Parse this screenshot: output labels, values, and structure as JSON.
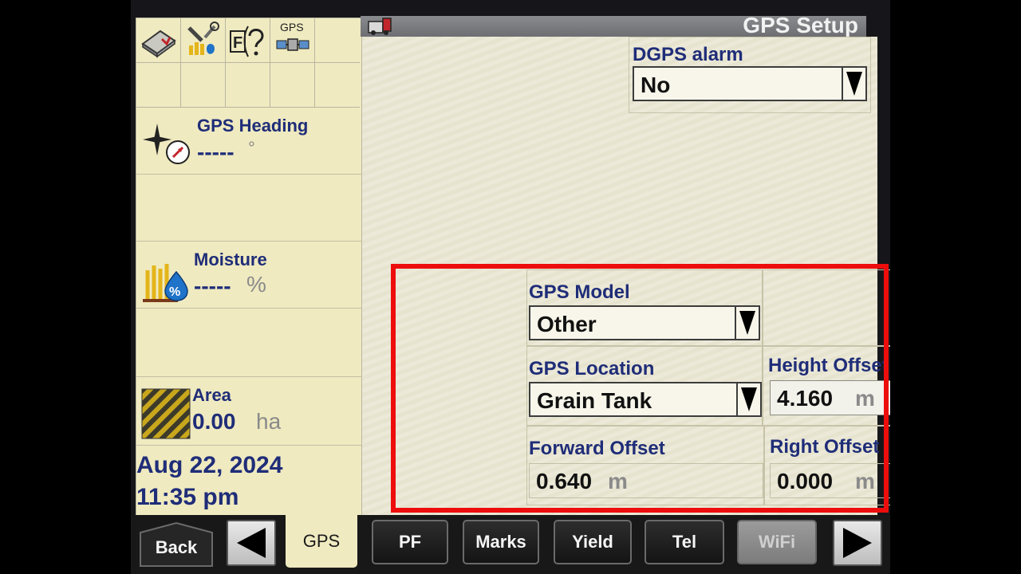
{
  "header": {
    "title": "GPS Setup"
  },
  "left_panel": {
    "icon_grid": [
      {
        "icon": "book-icon"
      },
      {
        "icon": "tools-icon"
      },
      {
        "icon": "help-icon"
      },
      {
        "icon": "gps-satellite-icon",
        "label": "GPS"
      }
    ],
    "gps_heading": {
      "label": "GPS Heading",
      "value": "-----",
      "unit": "°"
    },
    "moisture": {
      "label": "Moisture",
      "value": "-----",
      "unit": "%"
    },
    "area": {
      "label": "Area",
      "value": "0.00",
      "unit": "ha"
    },
    "date": "Aug 22, 2024",
    "time": "11:35 pm"
  },
  "form": {
    "dgps_alarm": {
      "label": "DGPS alarm",
      "value": "No"
    },
    "gps_model": {
      "label": "GPS Model",
      "value": "Other"
    },
    "gps_location": {
      "label": "GPS Location",
      "value": "Grain Tank"
    },
    "height_offset": {
      "label": "Height Offset",
      "value": "4.160",
      "unit": "m"
    },
    "forward_offset": {
      "label": "Forward Offset",
      "value": "0.640",
      "unit": "m"
    },
    "right_offset": {
      "label": "Right Offset",
      "value": "0.000",
      "unit": "m"
    }
  },
  "bottom_bar": {
    "back": "Back",
    "gps_tab": "GPS",
    "buttons": [
      "PF",
      "Marks",
      "Yield",
      "Tel",
      "WiFi"
    ]
  },
  "colors": {
    "highlight": "#ee0d0d",
    "label_blue": "#1f2d78",
    "panel_bg": "#efeac0"
  }
}
